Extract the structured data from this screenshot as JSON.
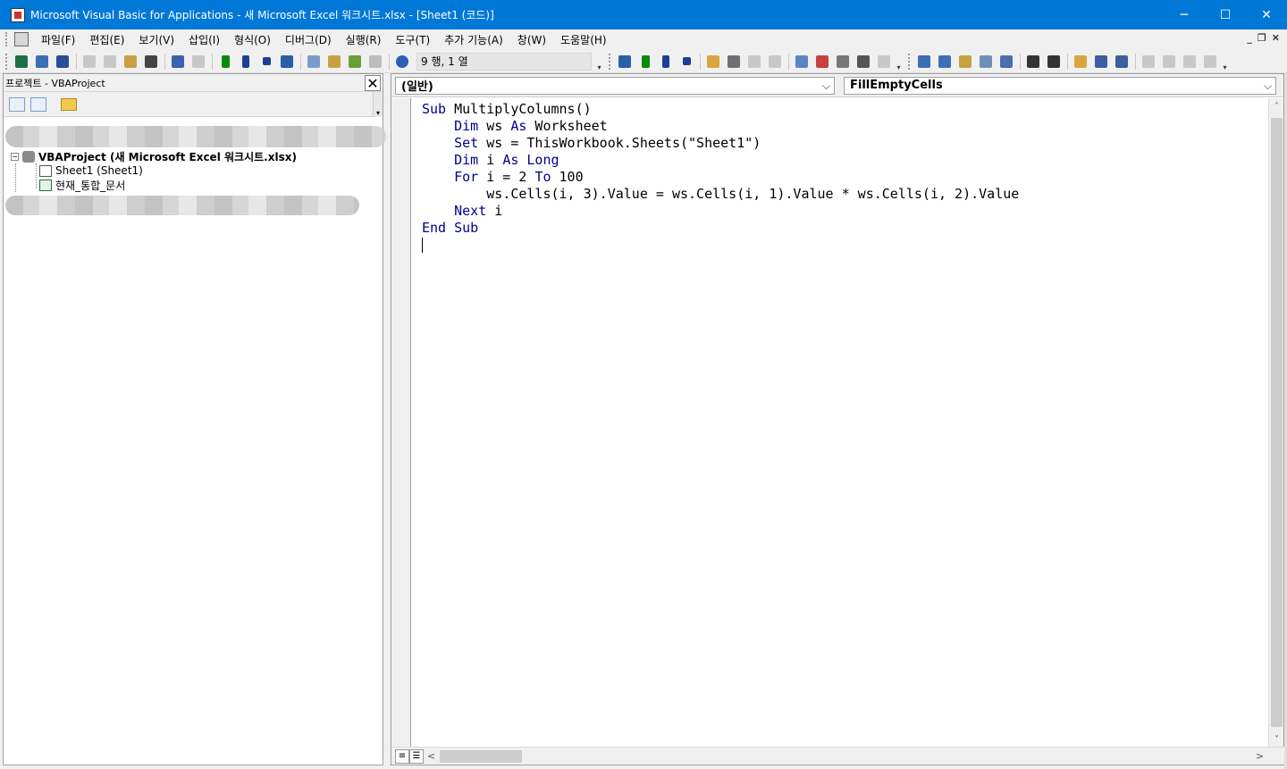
{
  "window": {
    "title": "Microsoft Visual Basic for Applications - 새 Microsoft Excel 워크시트.xlsx - [Sheet1 (코드)]",
    "minimize": "─",
    "maximize": "☐",
    "close": "✕"
  },
  "menu": {
    "items": [
      "파일(F)",
      "편집(E)",
      "보기(V)",
      "삽입(I)",
      "형식(O)",
      "디버그(D)",
      "실행(R)",
      "도구(T)",
      "추가 기능(A)",
      "창(W)",
      "도움말(H)"
    ],
    "mdi_min": "_",
    "mdi_restore": "❐",
    "mdi_close": "✕"
  },
  "toolbar": {
    "cursor_position": "9 행, 1 열",
    "icons": {
      "excel": "#1d7044",
      "insert": "#3c6fb4",
      "save": "#2a4e9a",
      "run": "#0a8a0a",
      "break": "#1c3f94",
      "reset": "#1c3f94",
      "help": "#2b5fb8"
    }
  },
  "project": {
    "title": "프로젝트 - VBAProject",
    "close": "✕",
    "tree": {
      "root_label": "VBAProject (새 Microsoft Excel 워크시트.xlsx)",
      "expander": "−",
      "children": [
        "Sheet1 (Sheet1)",
        "현재_통합_문서"
      ]
    }
  },
  "code": {
    "object_dropdown": "(일반)",
    "procedure_dropdown": "FillEmptyCells",
    "chevron": "⌵",
    "lines": {
      "l1_kw": "Sub",
      "l1_rest": " MultiplyColumns()",
      "l2_indent": "    ",
      "l2_kw1": "Dim",
      "l2_mid": " ws ",
      "l2_kw2": "As",
      "l2_rest": " Worksheet",
      "l3_kw": "Set",
      "l3_rest": " ws = ThisWorkbook.Sheets(\"Sheet1\")",
      "l4_kw1": "Dim",
      "l4_mid": " i ",
      "l4_kw2": "As",
      "l4_sp": " ",
      "l4_kw3": "Long",
      "l5_kw1": "For",
      "l5_mid": " i = 2 ",
      "l5_kw2": "To",
      "l5_rest": " 100",
      "l6_indent": "        ",
      "l6_rest": "ws.Cells(i, 3).Value = ws.Cells(i, 1).Value * ws.Cells(i, 2).Value",
      "l7_kw": "Next",
      "l7_rest": " i",
      "l8_kw1": "End",
      "l8_sp": " ",
      "l8_kw2": "Sub"
    }
  },
  "scroll": {
    "up": "˄",
    "down": "˅",
    "left": "<",
    "right": ">",
    "view_proc": "≡",
    "view_full": "☰"
  }
}
